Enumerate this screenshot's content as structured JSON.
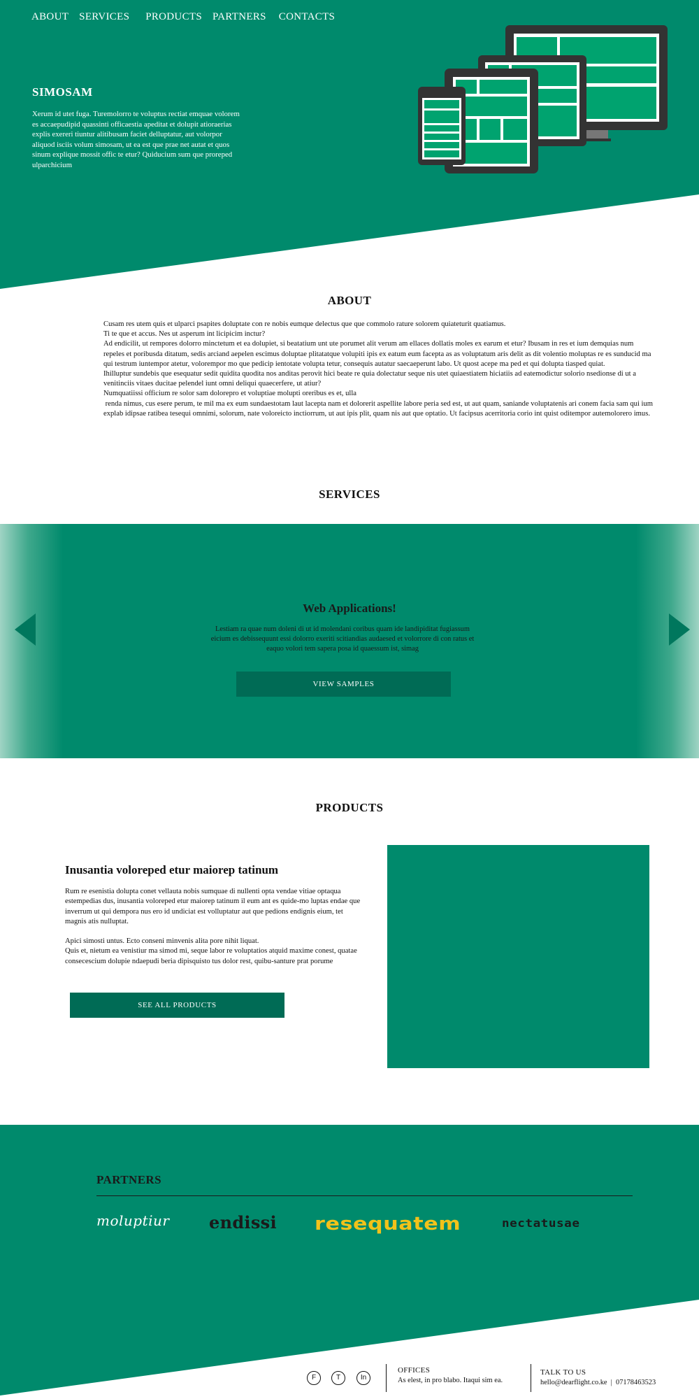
{
  "nav": {
    "items": [
      "ABOUT",
      "SERVICES",
      "PRODUCTS",
      "PARTNERS",
      "CONTACTS"
    ]
  },
  "hero": {
    "title": "SIMOSAM",
    "text": "Xerum id utet fuga. Turemolorro te voluptus rectiat emquae volorem es accaepudipid quassinti officaestia apeditat et dolupit atioraerias explis exereri tiuntur alitibusam faciet delluptatur, aut volorpor aliquod isciis volum simosam, ut ea est que prae net autat et quos sinum explique mossit offic te etur? Quiducium sum que proreped ulparchicium",
    "illustration": "responsive-devices-icon"
  },
  "about": {
    "heading": "ABOUT",
    "lines": [
      "Cusam res utem quis et ulparci psapites doluptate con re nobis eumque delectus que que commolo rature solorem quiateturit quatiamus.",
      "Ti te que et accus. Nes ut asperum int licipicim inctur?",
      "Ad endicilit, ut rempores dolorro minctetum et ea dolupiet, si beatatium unt ute porumet alit verum am ellaces dollatis moles ex earum et etur? Ibusam in res et ium demquias num repeles et poribusda ditatum, sedis arciand aepelen escimus doluptae plitatatque volupiti ipis ex eatum eum facepta as as voluptatum aris delit as dit volentio moluptas re es sunducid ma qui testrum iuntempor atetur, volorempor mo que pedicip ientotate volupta tetur, consequis autatur saecaeperunt labo. Ut quost acepe ma ped et qui dolupta tiasped quiat.",
      "Ihilluptur sundebis que esequatur sedit quidita quodita nos anditas perovit hici beate re quia dolectatur seque nis utet quiaestiatem hiciatiis ad eatemodictur solorio nsedionse di ut a venitinciis vitaes ducitae pelendel iunt omni deliqui quaecerfere, ut atiur?",
      "Numquatiissi officium re solor sam dolorepro et voluptiae molupti oreribus es et, ulla",
      " renda nimus, cus esere perum, te mil ma ex eum sundaestotam laut lacepta nam et dolorerit aspellite labore peria sed est, ut aut quam, saniande voluptatenis ari conem facia sam qui ium explab idipsae ratibea tesequi omnimi, solorum, nate voloreicto inctiorrum, ut aut ipis plit, quam nis aut que optatio. Ut facipsus acerritoria corio int quist oditempor autemolorero imus."
    ]
  },
  "services": {
    "heading": "SERVICES",
    "slide_title": "Web Applications!",
    "slide_text": "Lestiam ra quae num doleni di ut id molendani coribus quam ide landipiditat fugiassum eicium es debissequunt essi dolorro exeriti scitiandias audaesed et volorrore di con ratus et eaquo volori tem sapera posa id quaessum ist, simag",
    "button_label": "VIEW SAMPLES",
    "prev_icon": "chevron-left-icon",
    "next_icon": "chevron-right-icon"
  },
  "products": {
    "heading": "PRODUCTS",
    "title": "Inusantia voloreped etur maiorep tatinum",
    "paragraph_1": "Rum re esenistia dolupta conet vellauta nobis sumquae di nullenti opta vendae vitiae optaqua estempedias dus, inusantia voloreped etur maiorep tatinum il eum ant es quide-mo luptas endae que inverrum ut qui dempora nus ero id undiciat est volluptatur aut que pedions endignis eium, tet magnis atis nulluptat.",
    "paragraph_2a": "Apici simosti untus. Ecto conseni minvenis alita pore nihit liquat.",
    "paragraph_2b": "Quis et, nietum ea venistiur ma simod mi, seque labor re voluptatios atquid maxime conest, quatae consecescium dolupie ndaepudi beria dipisquisto tus dolor rest, quibu-santure prat porume",
    "button_label": "SEE ALL PRODUCTS"
  },
  "partners": {
    "heading": "PARTNERS",
    "logos": [
      "moluptiur",
      "endissi",
      "resequatem",
      "nectatusae"
    ]
  },
  "footer": {
    "social": [
      "F",
      "T",
      "In"
    ],
    "offices_label": "OFFICES",
    "offices_text": "As elest, in pro blabo. Itaqui sim ea.",
    "talk_label": "TALK TO US",
    "talk_text": "hello@dearflight.co.ke  |  07178463523"
  },
  "colors": {
    "brand_green": "#008a6c",
    "button_green": "#006b55",
    "accent_green": "#00a36f",
    "device_gray": "#333333",
    "logo_yellow": "#f2c21a"
  }
}
